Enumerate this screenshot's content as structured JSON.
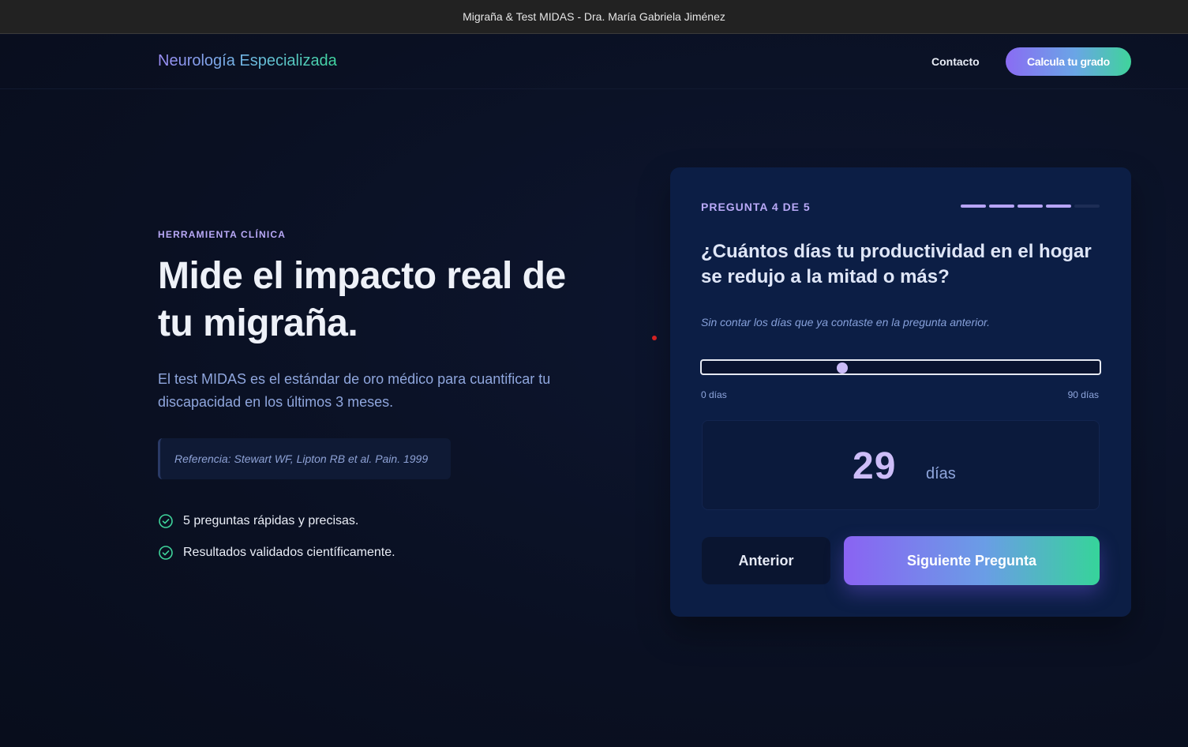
{
  "window": {
    "title": "Migraña & Test MIDAS - Dra. María Gabriela Jiménez"
  },
  "nav": {
    "logo": "Neurología Especializada",
    "contact": "Contacto",
    "cta": "Calcula tu grado"
  },
  "hero": {
    "eyebrow": "HERRAMIENTA CLÍNICA",
    "headline": "Mide el impacto real de tu migraña.",
    "lead": "El test MIDAS es el estándar de oro médico para cuantificar tu discapacidad en los últimos 3 meses.",
    "reference": "Referencia: Stewart WF, Lipton RB et al. Pain. 1999",
    "features": [
      {
        "icon": "check-circle-icon",
        "text": "5 preguntas rápidas y precisas."
      },
      {
        "icon": "check-circle-icon",
        "text": "Resultados validados científicamente."
      }
    ]
  },
  "quiz": {
    "step_label": "PREGUNTA 4 DE 5",
    "current_step": 4,
    "total_steps": 5,
    "question": "¿Cuántos días tu productividad en el hogar se redujo a la mitad o más?",
    "hint": "Sin contar los días que ya contaste en la pregunta anterior.",
    "slider": {
      "min": 0,
      "max": 90,
      "value": 29
    },
    "min_label": "0 días",
    "max_label": "90 días",
    "value_display": "29",
    "unit": "días",
    "prev_label": "Anterior",
    "next_label": "Siguiente Pregunta"
  },
  "colors": {
    "accent_purple": "#8a63f3",
    "accent_green": "#36d49a",
    "card_bg": "#0c1e45",
    "page_bg": "#0a1022"
  }
}
